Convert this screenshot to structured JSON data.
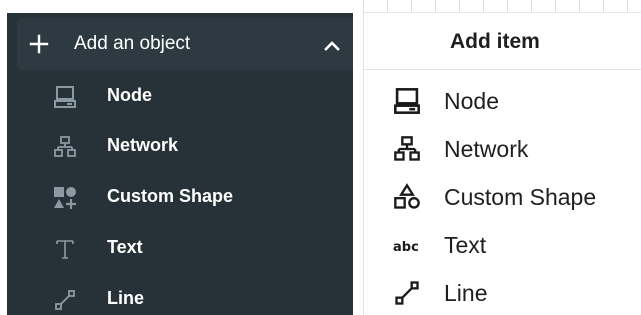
{
  "left_panel": {
    "header": {
      "title": "Add an object",
      "expand_icon": "plus-icon",
      "collapse_icon": "chevron-up-icon"
    },
    "items": [
      {
        "label": "Node",
        "icon": "computer-icon"
      },
      {
        "label": "Network",
        "icon": "network-icon"
      },
      {
        "label": "Custom Shape",
        "icon": "shapes-icon"
      },
      {
        "label": "Text",
        "icon": "text-icon"
      },
      {
        "label": "Line",
        "icon": "line-icon"
      }
    ]
  },
  "right_panel": {
    "header": {
      "title": "Add item"
    },
    "items": [
      {
        "label": "Node",
        "icon": "computer-icon"
      },
      {
        "label": "Network",
        "icon": "network-icon"
      },
      {
        "label": "Custom Shape",
        "icon": "shapes-icon"
      },
      {
        "label": "Text",
        "icon": "abc-text-icon"
      },
      {
        "label": "Line",
        "icon": "line-icon"
      }
    ]
  },
  "colors": {
    "left_background": "#263238",
    "left_header_background": "#2e3a41",
    "left_icon": "#8a9aa3",
    "left_text": "#ffffff",
    "right_background": "#ffffff",
    "right_text": "#202020"
  }
}
